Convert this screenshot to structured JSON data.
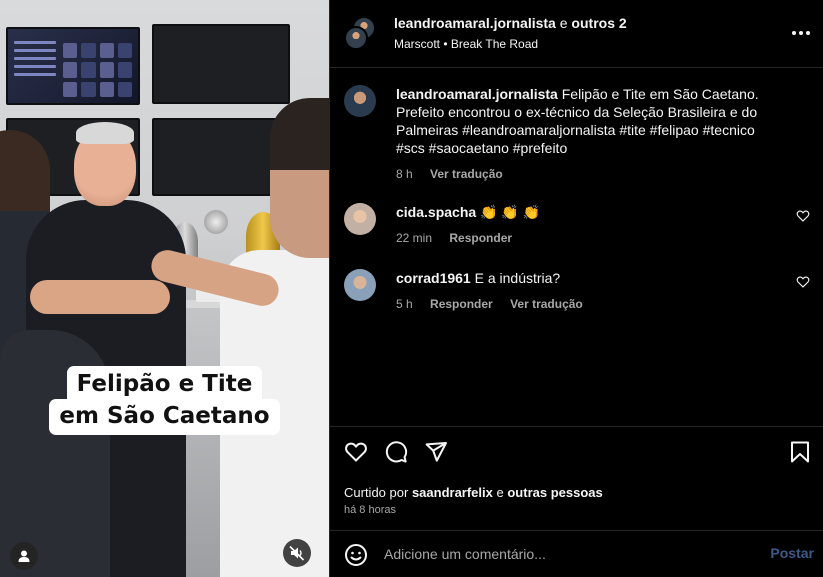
{
  "post": {
    "header": {
      "username": "leandroamaral.jornalista",
      "joiner": "e",
      "collaborators": "outros 2",
      "audio_artist": "Marscott",
      "audio_separator": "•",
      "audio_track": "Break The Road"
    },
    "media": {
      "caption_line1": "Felipão e Tite",
      "caption_line2": "em São Caetano"
    },
    "caption": {
      "username": "leandroamaral.jornalista",
      "text": "Felipão e Tite em São Caetano. Prefeito encontrou o ex-técnico da Seleção Brasileira e do Palmeiras #leandroamaraljornalista #tite #felipao #tecnico #scs #saocaetano #prefeito",
      "time": "8 h",
      "translate": "Ver tradução"
    },
    "comments": [
      {
        "username": "cida.spacha",
        "text": "👏 👏 👏",
        "time": "22 min",
        "reply": "Responder"
      },
      {
        "username": "corrad1961",
        "text": "E a indústria?",
        "time": "5 h",
        "reply": "Responder",
        "translate": "Ver tradução"
      }
    ],
    "likes": {
      "prefix": "Curtido por",
      "user": "saandrarfelix",
      "joiner": "e",
      "others": "outras pessoas"
    },
    "time_ago": "há 8 horas",
    "composer": {
      "placeholder": "Adicione um comentário...",
      "post_label": "Postar"
    },
    "icons": {
      "more": "more-options-icon",
      "like": "heart-icon",
      "comment": "comment-icon",
      "share": "share-icon",
      "save": "bookmark-icon",
      "emoji": "emoji-icon",
      "tagged": "user-tag-icon",
      "mute": "muted-audio-icon"
    },
    "colors": {
      "background": "#000000",
      "text": "#f5f5f5",
      "muted": "#a8a8a8",
      "divider": "#262626",
      "post_button": "#3c5b8a"
    }
  }
}
